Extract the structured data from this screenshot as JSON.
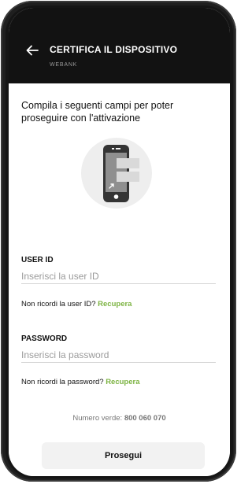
{
  "header": {
    "title": "CERTIFICA IL DISPOSITIVO",
    "subtitle": "WEBANK",
    "back_icon": "arrow-left-icon"
  },
  "main": {
    "intro": "Compila i seguenti campi per poter proseguire con l'attivazione",
    "illustration_icon": "smartphone-certify-icon",
    "user_id": {
      "label": "USER ID",
      "placeholder": "Inserisci la user ID",
      "help_text": "Non ricordi la user ID?",
      "help_link": "Recupera"
    },
    "password": {
      "label": "PASSWORD",
      "placeholder": "Inserisci la password",
      "help_text": "Non ricordi la password?",
      "help_link": "Recupera"
    },
    "phone_label": "Numero verde:",
    "phone_number": "800 060 070",
    "submit_label": "Prosegui"
  },
  "colors": {
    "header_bg": "#121212",
    "accent_green": "#7cb342",
    "button_bg": "#f2f2f2"
  }
}
